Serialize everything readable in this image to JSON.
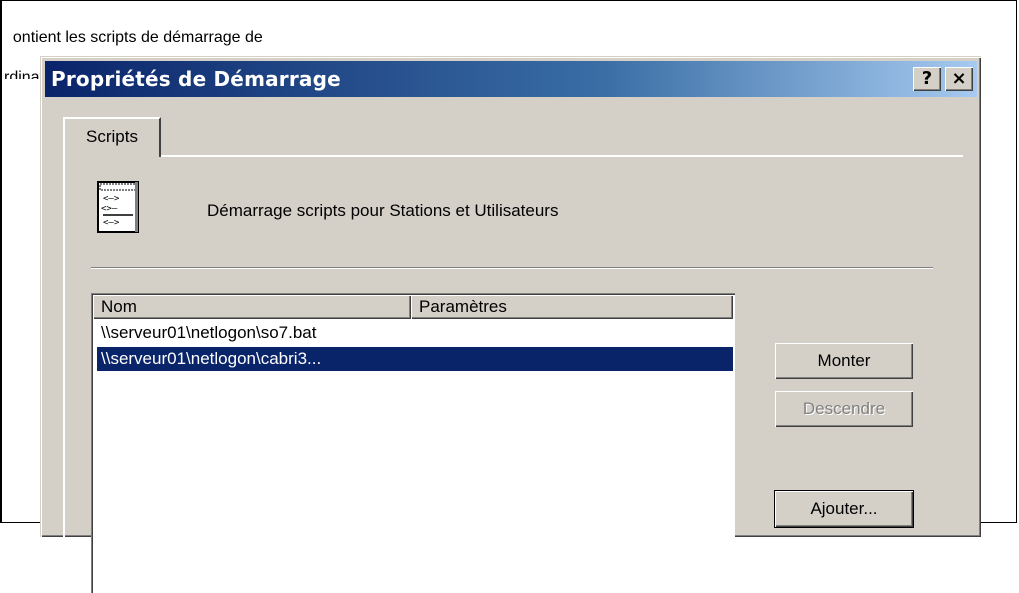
{
  "background": {
    "line1": "ontient les scripts de démarrage de",
    "line2": "rdinateur"
  },
  "dialog": {
    "title": "Propriétés de Démarrage",
    "help_label": "?",
    "close_label": "×",
    "tab_label": "Scripts",
    "header_text": "Démarrage scripts pour Stations et Utilisateurs",
    "icon": "script-document-icon",
    "columns": [
      "Nom",
      "Paramètres"
    ],
    "rows": [
      {
        "name": "\\\\serveur01\\netlogon\\so7.bat",
        "params": "",
        "selected": false
      },
      {
        "name": "\\\\serveur01\\netlogon\\cabri3...",
        "params": "",
        "selected": true
      }
    ],
    "buttons": {
      "up": "Monter",
      "down": "Descendre",
      "add": "Ajouter..."
    }
  },
  "colors": {
    "face": "#d4d0c8",
    "title_start": "#0a246a",
    "title_end": "#a6caf0",
    "selection": "#0a246a"
  }
}
